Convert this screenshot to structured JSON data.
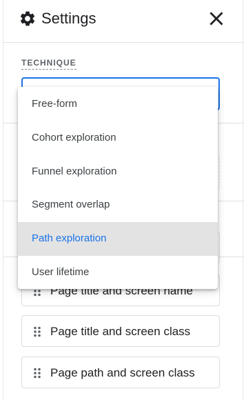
{
  "header": {
    "title": "Settings",
    "icon": "gear-icon",
    "close_icon": "close-icon"
  },
  "technique": {
    "label": "TECHNIQUE",
    "options": [
      "Free-form",
      "Cohort exploration",
      "Funnel exploration",
      "Segment overlap",
      "Path exploration",
      "User lifetime"
    ],
    "selected": "Path exploration"
  },
  "dimensions": {
    "items": [
      "Page title and screen name",
      "Page title and screen class",
      "Page path and screen class"
    ]
  },
  "colors": {
    "accent": "#1a73e8",
    "selected_bg": "#e3e3e3"
  }
}
